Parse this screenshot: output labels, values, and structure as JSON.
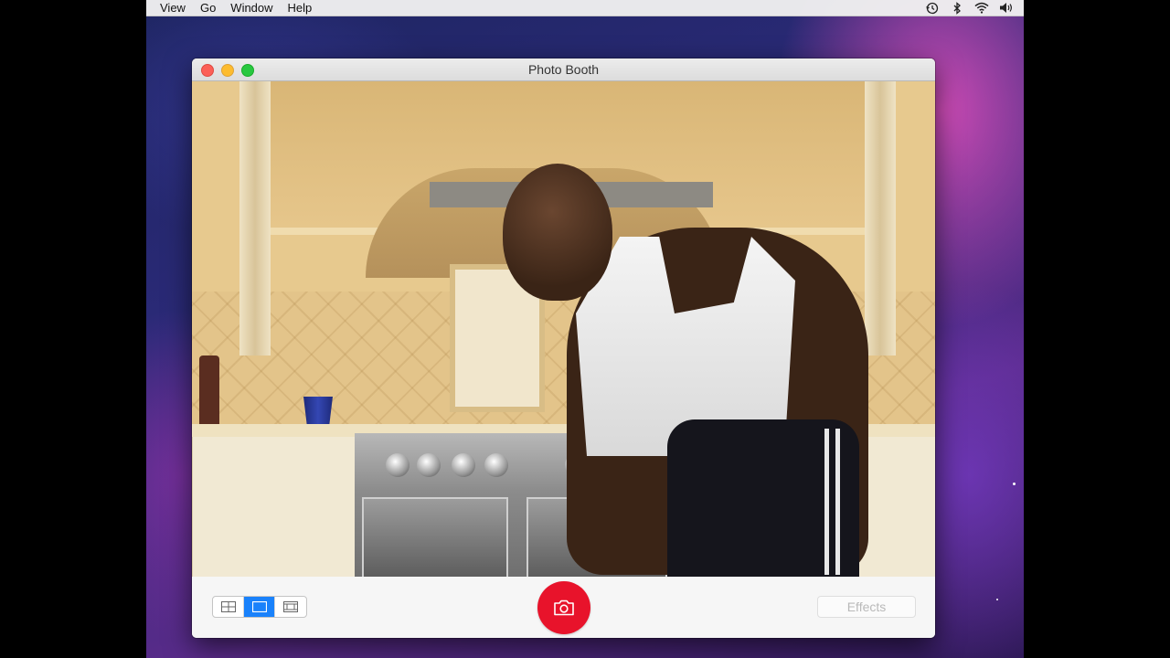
{
  "menubar": {
    "items": [
      "View",
      "Go",
      "Window",
      "Help"
    ],
    "status_icons": [
      "time-machine-icon",
      "bluetooth-icon",
      "wifi-icon",
      "volume-icon"
    ]
  },
  "window": {
    "title": "Photo Booth",
    "traffic_lights": {
      "close_color": "#fc5f57",
      "minimize_color": "#fdbc2e",
      "maximize_color": "#28c840"
    }
  },
  "preview": {
    "content": "live-camera-preview"
  },
  "toolbar": {
    "layout_modes": [
      "four-up-grid-icon",
      "single-photo-icon",
      "filmstrip-icon"
    ],
    "active_layout_mode": "single-photo-icon",
    "shutter_icon": "camera-icon",
    "shutter_color": "#e8132b",
    "effects_label": "Effects"
  },
  "colors": {
    "accent": "#1a82fb"
  }
}
